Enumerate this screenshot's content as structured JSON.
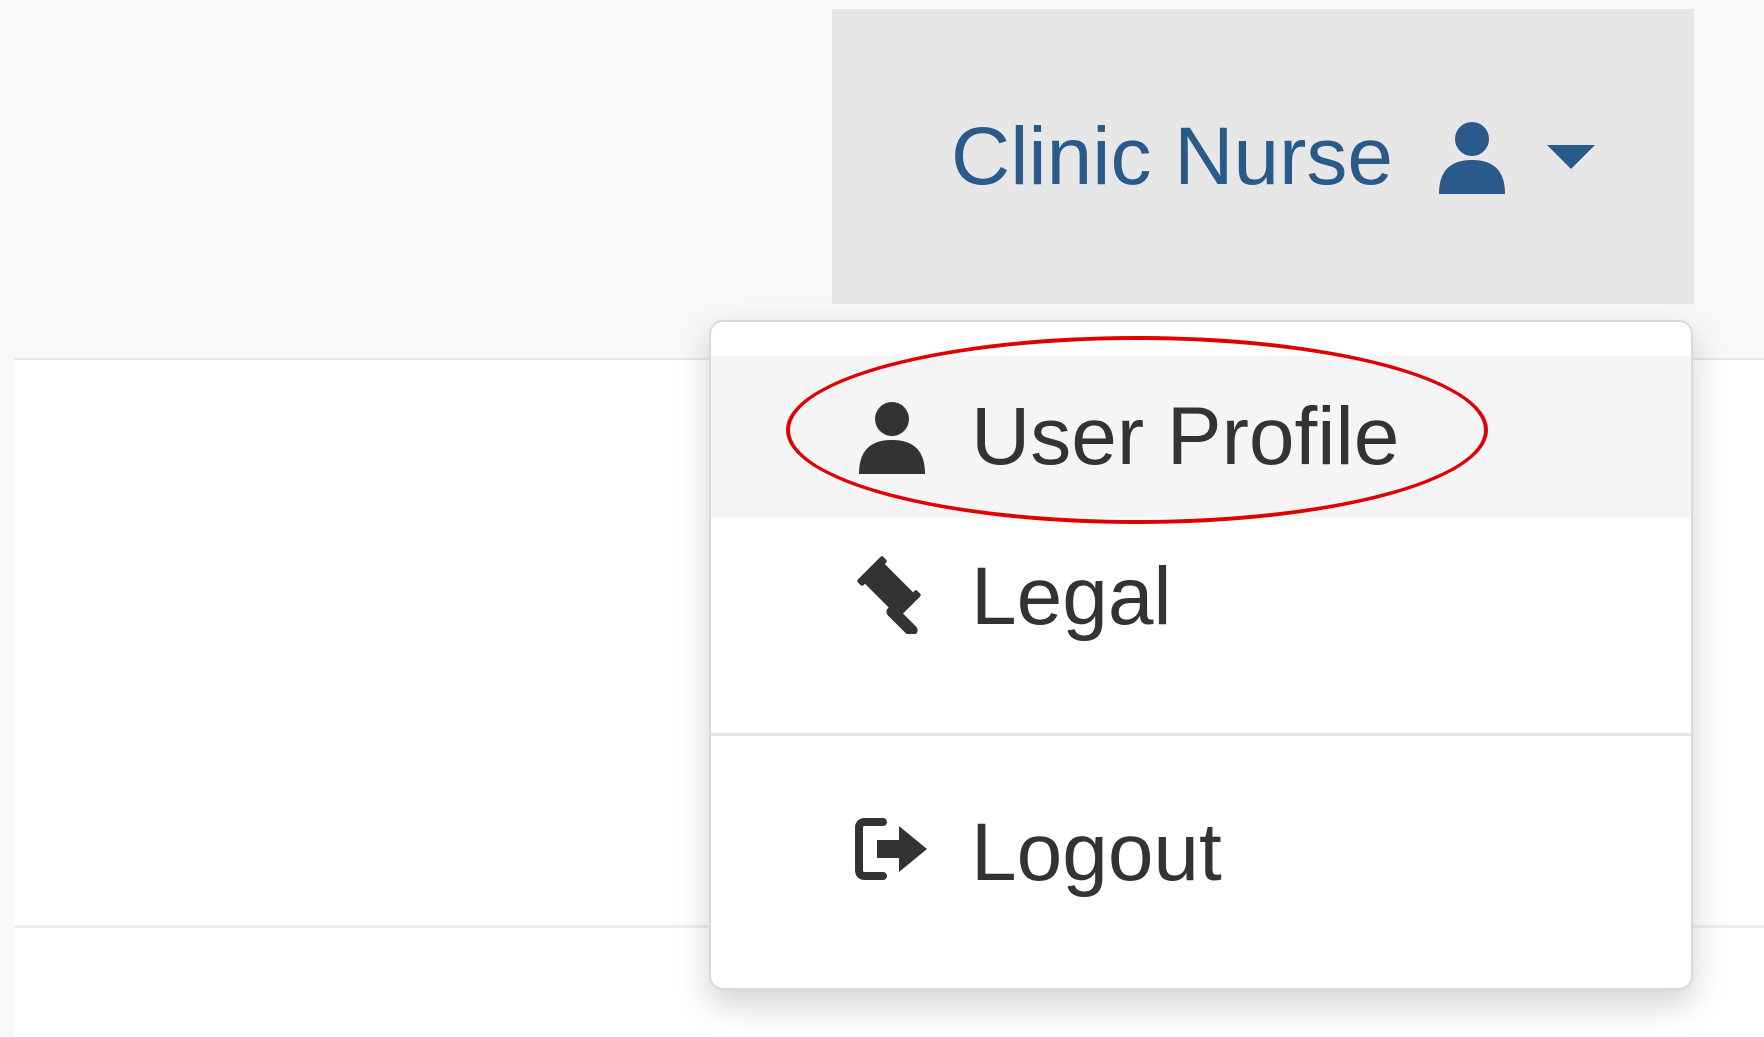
{
  "header": {
    "user_menu": {
      "name": "Clinic Nurse",
      "icon": "user-icon",
      "caret": "caret-down-icon",
      "color": "#2a5a8a"
    }
  },
  "dropdown": {
    "items": [
      {
        "label": "User Profile",
        "icon": "user-icon"
      },
      {
        "label": "Legal",
        "icon": "gavel-icon"
      },
      {
        "label": "Logout",
        "icon": "sign-out-icon"
      }
    ]
  },
  "annotation": {
    "color": "#e00000"
  }
}
